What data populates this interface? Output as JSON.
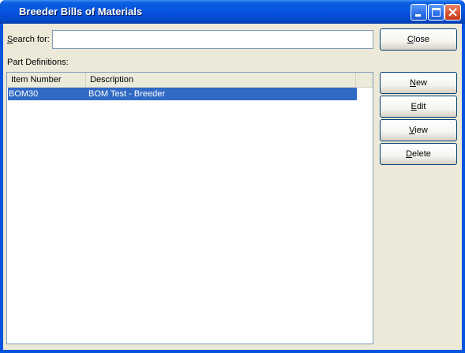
{
  "window": {
    "title": "Breeder Bills of Materials"
  },
  "search": {
    "label_prefix": "S",
    "label_rest": "earch for:",
    "value": ""
  },
  "list": {
    "label": "Part Definitions:",
    "columns": [
      "Item Number",
      "Description"
    ],
    "rows": [
      {
        "item_number": "BOM30",
        "description": "BOM  Test - Breeder",
        "selected": true
      }
    ]
  },
  "buttons": {
    "close": {
      "accel": "C",
      "rest": "lose"
    },
    "new": {
      "accel": "N",
      "rest": "ew"
    },
    "edit": {
      "accel": "E",
      "rest": "dit"
    },
    "view": {
      "accel": "V",
      "rest": "iew"
    },
    "delete": {
      "accel": "D",
      "rest": "elete"
    }
  },
  "colors": {
    "titlebar": "#0553df",
    "client_bg": "#ece9d8",
    "selection": "#316ac5"
  }
}
